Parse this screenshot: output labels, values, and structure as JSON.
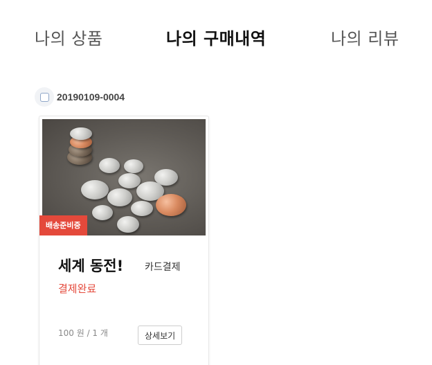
{
  "tabs": {
    "products": "나의 상품",
    "purchases": "나의 구매내역",
    "reviews": "나의 리뷰",
    "active": "purchases"
  },
  "order": {
    "id": "20190109-0004",
    "checked": false
  },
  "card": {
    "image_alt": "coins",
    "status_badge": "배송준비중",
    "product_name": "세계 동전!",
    "payment_method": "카드결제",
    "payment_status": "결제완료",
    "price_qty": "100 원 / 1 개",
    "detail_button": "상세보기"
  },
  "colors": {
    "accent": "#e4493b",
    "active_tab": "#111111",
    "inactive_tab": "#555555"
  }
}
